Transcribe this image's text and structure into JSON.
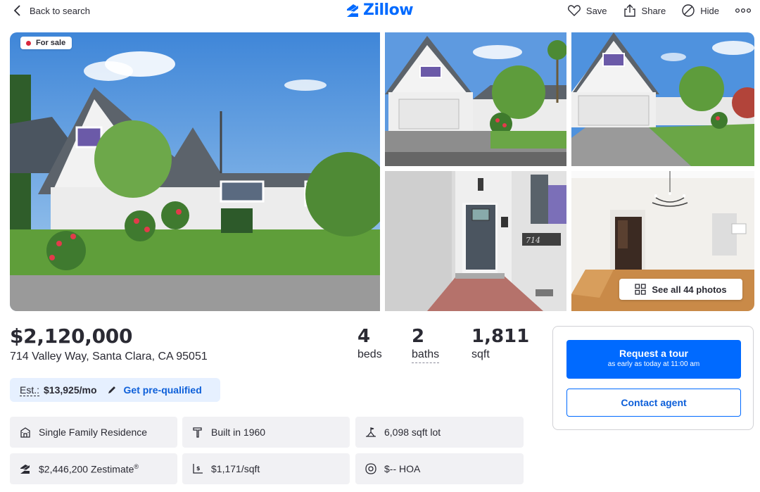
{
  "header": {
    "back_label": "Back to search",
    "logo_text": "Zillow",
    "actions": {
      "save": "Save",
      "share": "Share",
      "hide": "Hide"
    }
  },
  "photos": {
    "badge": "For sale",
    "see_all": "See all 44 photos",
    "door_number": "714"
  },
  "listing": {
    "price": "$2,120,000",
    "address": "714 Valley Way, Santa Clara, CA 95051",
    "beds_value": "4",
    "beds_label": "beds",
    "baths_value": "2",
    "baths_label": "baths",
    "sqft_value": "1,811",
    "sqft_label": "sqft"
  },
  "estimate": {
    "label": "Est.:",
    "value": "$13,925/mo",
    "link": "Get pre-qualified"
  },
  "facts": {
    "type": "Single Family Residence",
    "built": "Built in 1960",
    "lot": "6,098 sqft lot",
    "zestimate": "$2,446,200 Zestimate",
    "zestimate_mark": "®",
    "price_per_sqft": "$1,171/sqft",
    "hoa": "$-- HOA"
  },
  "contact": {
    "tour_label": "Request a tour",
    "tour_sub": "as early as today at 11:00 am",
    "agent_label": "Contact agent"
  },
  "colors": {
    "brand": "#006aff",
    "link": "#0d5fd9",
    "sale_dot": "#d9283d",
    "fact_bg": "#f1f1f4",
    "estimate_bg": "#e6f0ff"
  }
}
